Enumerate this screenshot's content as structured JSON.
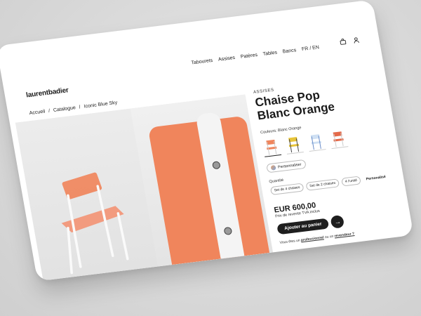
{
  "brand": {
    "logo": "laurentbadier"
  },
  "nav": {
    "items": [
      "Tabourets",
      "Assises",
      "Patères",
      "Tables",
      "Bancs",
      "FR / EN"
    ]
  },
  "breadcrumb": {
    "items": [
      "Accueil",
      "/",
      "Catalogue",
      "/",
      "Iconic Blue Sky"
    ]
  },
  "product": {
    "category": "ASSISES",
    "title_line1": "Chaise Pop",
    "title_line2": "Blanc Orange",
    "colors_label": "Couleurs: Blanc Orange",
    "personalize_label": "Personnaliser",
    "quantity_label": "Quantité",
    "quantity_options": [
      "Set de 4 chaises",
      "Set de 2 chaises",
      "4 l'unité",
      "Personalisé"
    ],
    "price": "EUR 600,00",
    "price_note": "Prix de revente TVA inclus",
    "add_to_cart": "Ajouter au panier",
    "footer_prefix": "Vous êtes un",
    "footer_pro": "professionnel",
    "footer_mid": "ou un",
    "footer_reseller": "revendeur ?"
  },
  "colors": {
    "accent_orange": "#f0855c",
    "dark": "#1e1e1e"
  }
}
